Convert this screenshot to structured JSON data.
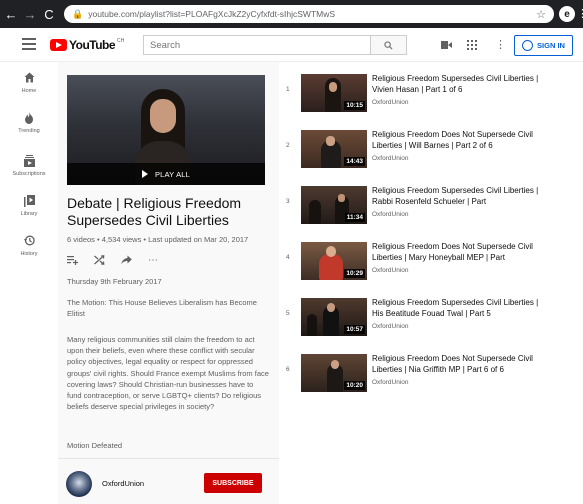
{
  "browser": {
    "url": "youtube.com/playlist?list=PLOAFgXcJkZ2yCyfxfdt-sIhjcSWTMwS",
    "profile_initial": "e"
  },
  "masthead": {
    "logo_word": "YouTube",
    "logo_sup": "CH",
    "search_placeholder": "Search",
    "signin_label": "SIGN IN"
  },
  "guide": {
    "items": [
      {
        "label": "Home",
        "icon": "home-icon"
      },
      {
        "label": "Trending",
        "icon": "flame-icon"
      },
      {
        "label": "Subscriptions",
        "icon": "subscriptions-icon"
      },
      {
        "label": "Library",
        "icon": "library-icon"
      },
      {
        "label": "History",
        "icon": "history-icon"
      }
    ]
  },
  "playlist": {
    "play_all_label": "PLAY ALL",
    "title": "Debate | Religious Freedom Supersedes Civil Liberties",
    "stats": "6 videos • 4,534 views • Last updated on Mar 20, 2017",
    "date": "Thursday 9th February 2017",
    "motion": "The Motion: This House Believes Liberalism has Become Elitist",
    "description": "Many religious communities still claim the freedom to act upon their beliefs, even where these conflict with secular policy objectives, legal equality or respect for oppressed groups' civil rights. Should France exempt Muslims from face covering laws? Should Christian-run businesses have to fund contraception, or serve LGBTQ+ clients? Do religious beliefs deserve special privileges in society?",
    "result": "Motion Defeated",
    "owner": "OxfordUnion",
    "subscribe_label": "SUBSCRIBE"
  },
  "videos": [
    {
      "index": "1",
      "title": "Religious Freedom Supersedes Civil Liberties | Vivien Hasan | Part 1 of 6",
      "channel": "OxfordUnion",
      "duration": "10:15"
    },
    {
      "index": "2",
      "title": "Religious Freedom Does Not Supersede Civil Liberties | Will Barnes | Part 2 of 6",
      "channel": "OxfordUnion",
      "duration": "14:43"
    },
    {
      "index": "3",
      "title": "Religious Freedom Supersedes Civil Liberties | Rabbi Rosenfeld Schueler | Part",
      "channel": "OxfordUnion",
      "duration": "11:34"
    },
    {
      "index": "4",
      "title": "Religious Freedom Does Not Supersede Civil Liberties | Mary Honeyball MEP | Part",
      "channel": "OxfordUnion",
      "duration": "10:29"
    },
    {
      "index": "5",
      "title": "Religious Freedom Supersedes Civil Liberties | His Beatitude Fouad Twal | Part 5",
      "channel": "OxfordUnion",
      "duration": "10:57"
    },
    {
      "index": "6",
      "title": "Religious Freedom Does Not Supersede Civil Liberties | Nia Griffith MP | Part 6 of 6",
      "channel": "OxfordUnion",
      "duration": "10:20"
    }
  ]
}
